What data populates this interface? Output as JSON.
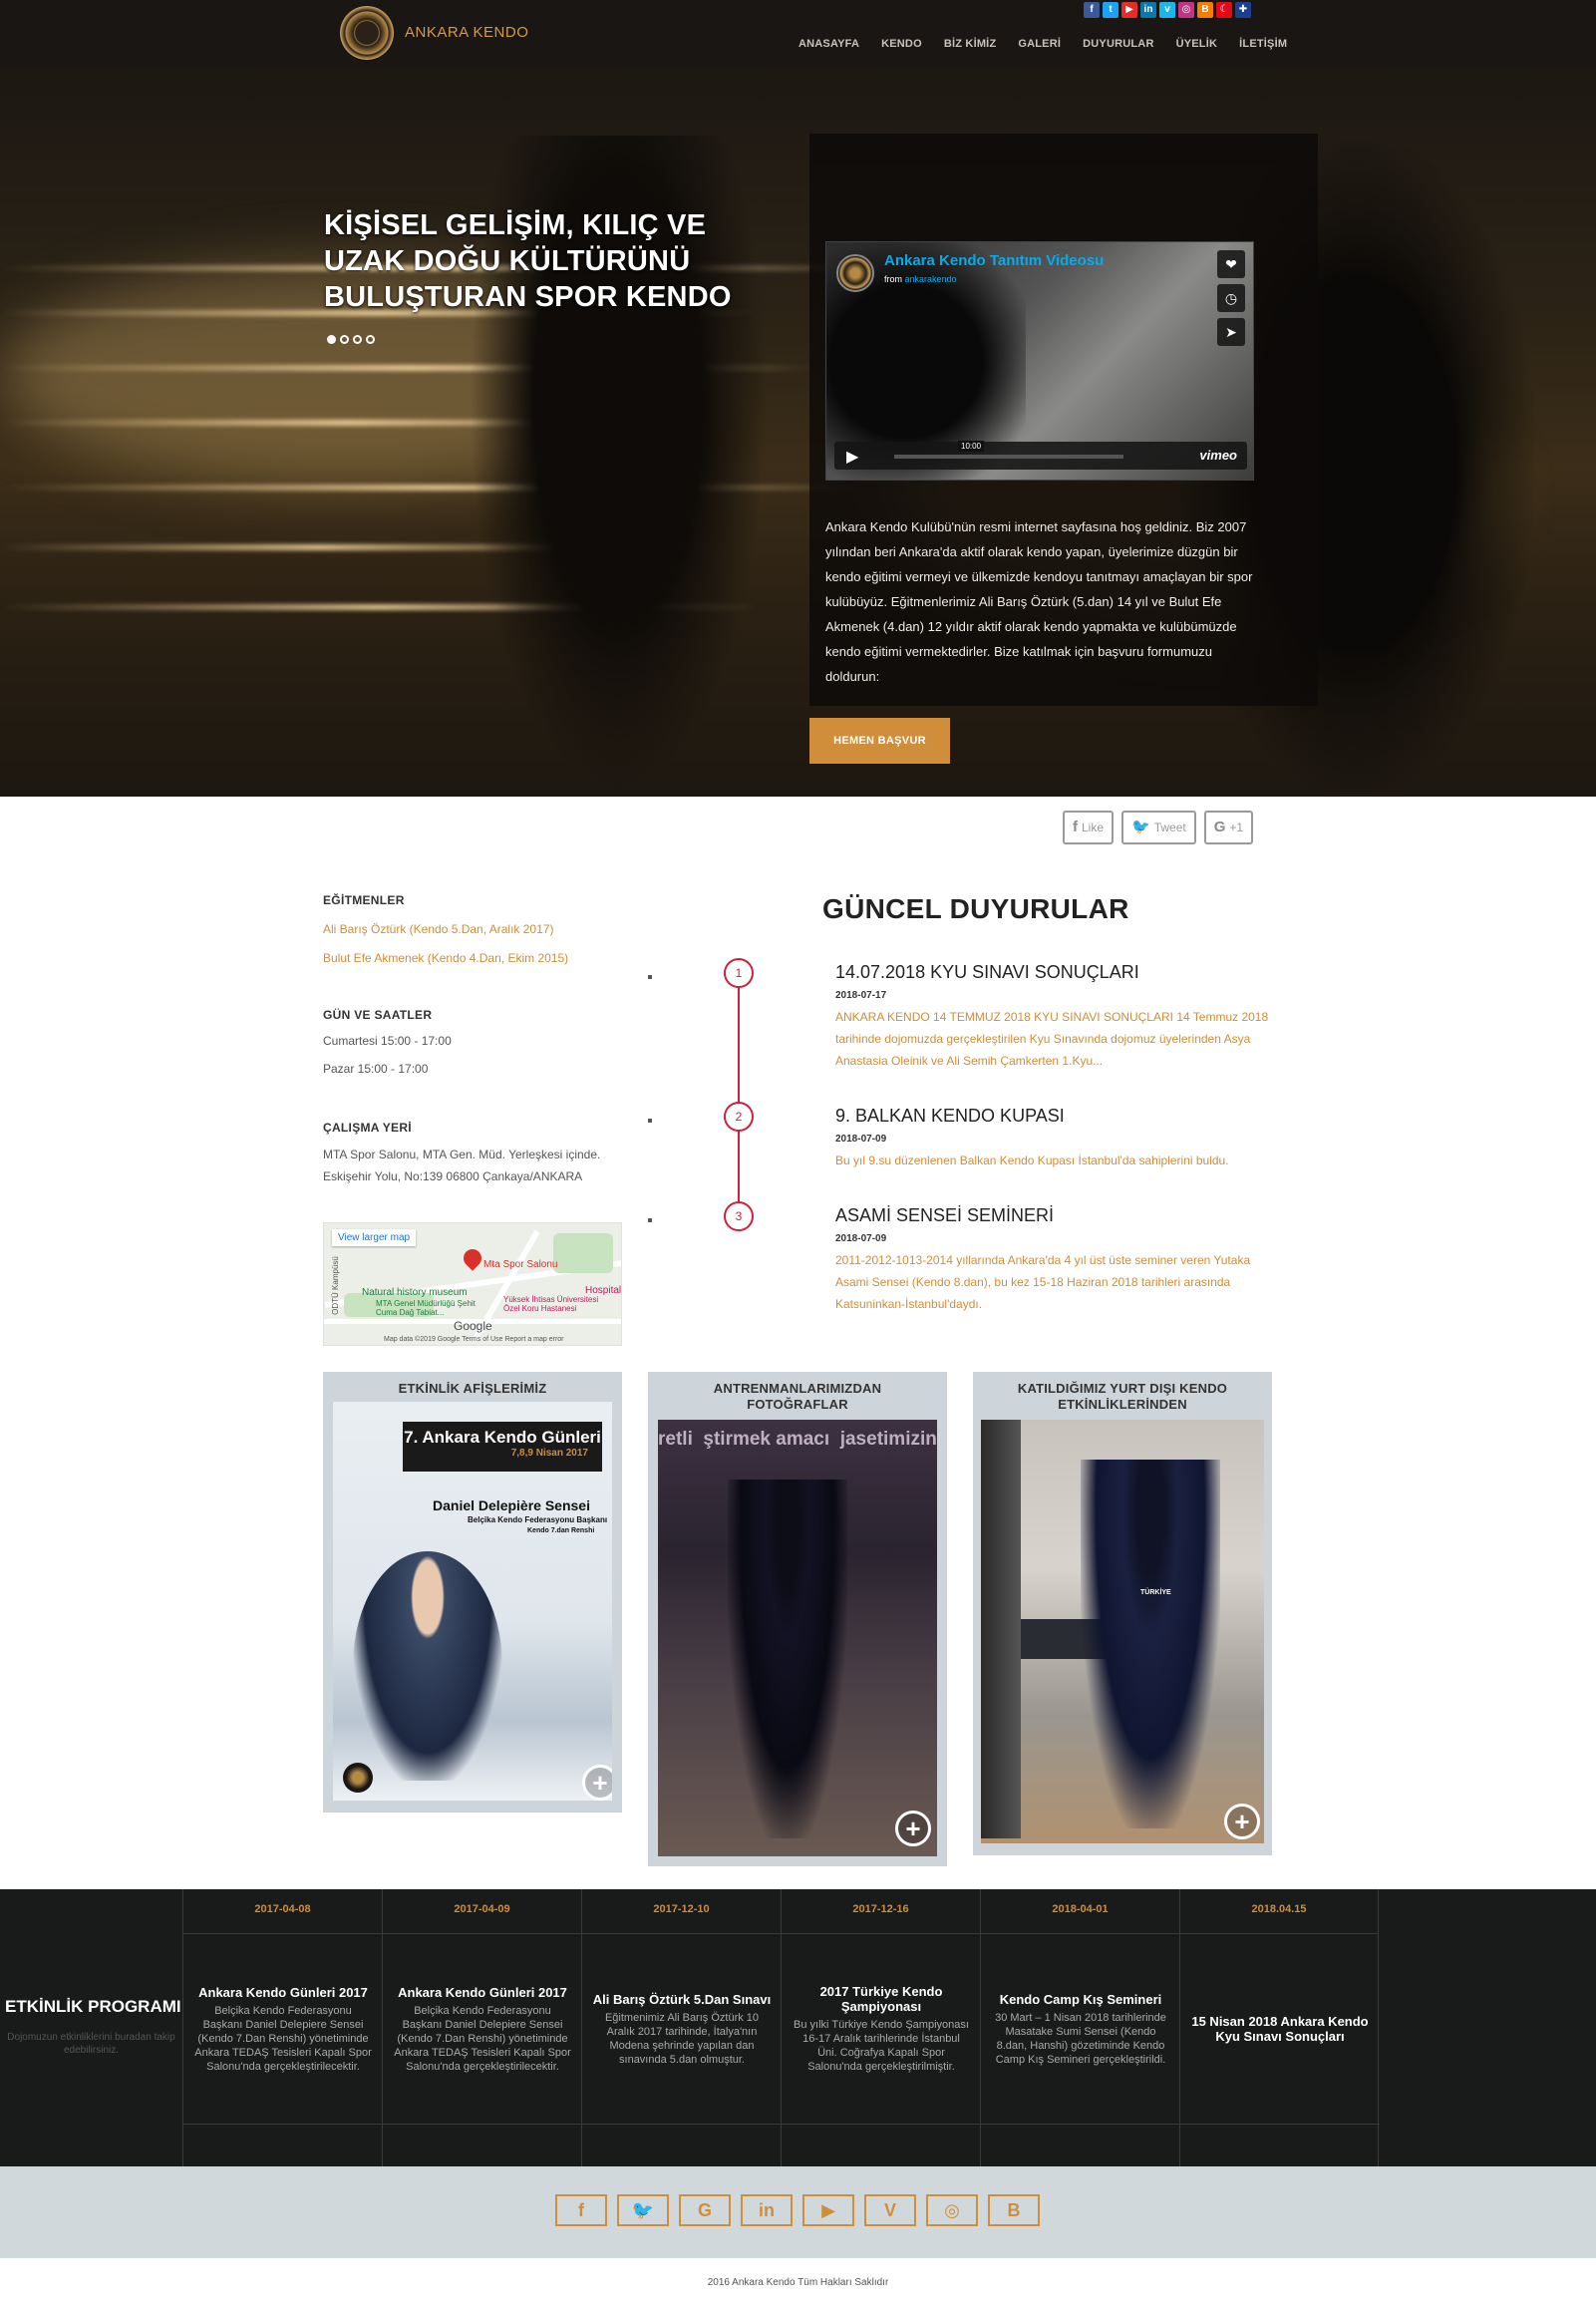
{
  "header": {
    "logo_text": "ANKARA KENDO",
    "nav": [
      "ANASAYFA",
      "KENDO",
      "BİZ KİMİZ",
      "GALERİ",
      "DUYURULAR",
      "ÜYELİK",
      "İLETİŞİM"
    ],
    "social_icons": [
      {
        "name": "facebook-icon",
        "glyph": "f",
        "color": "#3b5998"
      },
      {
        "name": "twitter-icon",
        "glyph": "t",
        "color": "#1da1f2"
      },
      {
        "name": "youtube-icon",
        "glyph": "▶",
        "color": "#e52d27"
      },
      {
        "name": "linkedin-icon",
        "glyph": "in",
        "color": "#0e76a8"
      },
      {
        "name": "vimeo-icon",
        "glyph": "v",
        "color": "#1ab7ea"
      },
      {
        "name": "instagram-icon",
        "glyph": "◎",
        "color": "#c13584"
      },
      {
        "name": "blogger-icon",
        "glyph": "B",
        "color": "#f57d00"
      },
      {
        "name": "flag-tr-icon",
        "glyph": "☾",
        "color": "#e30a17"
      },
      {
        "name": "flag-uk-icon",
        "glyph": "✚",
        "color": "#1c3f8f"
      }
    ]
  },
  "hero": {
    "title": "KİŞİSEL GELİŞİM, KILIÇ VE UZAK DOĞU KÜLTÜRÜNÜ BULUŞTURAN SPOR KENDO",
    "video": {
      "title": "Ankara Kendo Tanıtım Videosu",
      "from_prefix": "from",
      "from_user": "ankarakendo",
      "time": "10:00",
      "brand": "vimeo"
    },
    "description": "Ankara Kendo Kulübü'nün resmi internet sayfasına hoş geldiniz. Biz 2007 yılından beri Ankara'da aktif olarak kendo yapan, üyelerimize düzgün bir kendo eğitimi vermeyi ve ülkemizde kendoyu tanıtmayı amaçlayan bir spor kulübüyüz. Eğitmenlerimiz Ali Barış Öztürk (5.dan) 14 yıl ve Bulut Efe Akmenek (4.dan) 12 yıldır aktif olarak kendo yapmakta ve kulübümüzde kendo eğitimi vermektedirler. Bize katılmak için başvuru formumuzu doldurun:",
    "cta": "HEMEN BAŞVUR"
  },
  "share": {
    "like": "Like",
    "tweet": "Tweet",
    "gplus": "+1"
  },
  "info": {
    "trainers_h": "EĞİTMENLER",
    "trainers": [
      "Ali Barış Öztürk (Kendo 5.Dan, Aralık 2017)",
      "Bulut Efe Akmenek (Kendo 4.Dan, Ekim 2015)"
    ],
    "hours_h": "GÜN VE SAATLER",
    "hours": [
      "Cumartesi 15:00 - 17:00",
      "Pazar 15:00 - 17:00"
    ],
    "place_h": "ÇALIŞMA YERİ",
    "place": [
      "MTA Spor Salonu, MTA Gen. Müd. Yerleşkesi içinde.",
      "Eskişehir Yolu, No:139 06800 Çankaya/ANKARA"
    ],
    "map": {
      "larger": "View larger map",
      "pin": "Mta Spor Salonu",
      "museum": "Natural history museum",
      "museum2": "MTA Genel Müdürlüğü Şehit Cuma Dağ Tabiat...",
      "hospital": "Hospital",
      "hospital2": "Yüksek İhtisas Üniversitesi Özel Koru Hastanesi",
      "side": "ODTÜ Kampüsü",
      "google": "Google",
      "footer": "Map data ©2019 Google   Terms of Use   Report a map error"
    }
  },
  "news": {
    "title": "GÜNCEL DUYURULAR",
    "items": [
      {
        "num": "1",
        "title": "14.07.2018 KYU SINAVI SONUÇLARI",
        "date": "2018-07-17",
        "text": "ANKARA KENDO 14 TEMMUZ 2018 KYU SINAVI SONUÇLARI 14 Temmuz 2018 tarihinde dojomuzda gerçekleştirilen Kyu Sınavında dojomuz üyelerinden Asya Anastasia Oleinik ve Ali Semih Çamkerten 1.Kyu..."
      },
      {
        "num": "2",
        "title": "9. BALKAN KENDO KUPASI",
        "date": "2018-07-09",
        "text": "Bu yıl 9.su düzenlenen Balkan Kendo Kupası İstanbul'da sahiplerini buldu."
      },
      {
        "num": "3",
        "title": "ASAMİ SENSEİ SEMİNERİ",
        "date": "2018-07-09",
        "text": "2011-2012-1013-2014 yıllarında Ankara'da 4 yıl üst üste seminer veren Yutaka Asami Sensei (Kendo 8.dan), bu kez 15-18 Haziran 2018 tarihleri arasında Katsuninkan-İstanbul'daydı."
      }
    ]
  },
  "cards": [
    {
      "title": "ETKİNLİK AFİŞLERİMİZ",
      "poster_title": "7. Ankara Kendo Günleri",
      "poster_dates": "7,8,9 Nisan 2017",
      "poster_name": "Daniel Delepière Sensei",
      "poster_sub": "Belçika Kendo Federasyonu Başkanı",
      "poster_rank": "Kendo 7.dan Renshi"
    },
    {
      "title": "ANTRENMANLARIMIZDAN FOTOĞRAFLAR",
      "banner_text": "retli  ştirmek amacı  jasetimizin"
    },
    {
      "title": "KATILDIĞIMIZ YURT DIŞI KENDO ETKİNLİKLERİNDEN",
      "badge": "TÜRKİYE"
    }
  ],
  "events": {
    "title": "ETKİNLİK PROGRAMI",
    "subtitle": "Dojomuzun etkinliklerini buradan takip edebilirsiniz.",
    "items": [
      {
        "date": "2017-04-08",
        "name": "Ankara Kendo Günleri 2017",
        "text": "Belçika Kendo Federasyonu Başkanı Daniel Delepiere Sensei (Kendo 7.Dan Renshi) yönetiminde Ankara TEDAŞ Tesisleri Kapalı Spor Salonu'nda gerçekleştirilecektir."
      },
      {
        "date": "2017-04-09",
        "name": "Ankara Kendo Günleri 2017",
        "text": "Belçika Kendo Federasyonu Başkanı Daniel Delepiere Sensei (Kendo 7.Dan Renshi) yönetiminde Ankara TEDAŞ Tesisleri Kapalı Spor Salonu'nda gerçekleştirilecektir."
      },
      {
        "date": "2017-12-10",
        "name": "Ali Barış Öztürk 5.Dan Sınavı",
        "text": "Eğitmenimiz Ali Barış Öztürk 10 Aralık 2017 tarihinde, İtalya'nın Modena şehrinde yapılan dan sınavında 5.dan olmuştur."
      },
      {
        "date": "2017-12-16",
        "name": "2017 Türkiye Kendo Şampiyonası",
        "text": "Bu yılki Türkiye Kendo Şampiyonası 16-17 Aralık tarihlerinde İstanbul Üni. Coğrafya Kapalı Spor Salonu'nda gerçekleştirilmiştir."
      },
      {
        "date": "2018-04-01",
        "name": "Kendo Camp Kış Semineri",
        "text": "30 Mart – 1 Nisan 2018 tarihlerinde Masatake Sumi Sensei (Kendo 8.dan, Hanshi) gözetiminde Kendo Camp Kış Semineri gerçekleştirildi."
      },
      {
        "date": "2018.04.15",
        "name": "15 Nisan 2018 Ankara Kendo Kyu Sınavı Sonuçları",
        "text": ""
      }
    ]
  },
  "footer": {
    "icons": [
      {
        "name": "facebook-icon",
        "glyph": "f"
      },
      {
        "name": "twitter-icon",
        "glyph": "🐦"
      },
      {
        "name": "google-icon",
        "glyph": "G"
      },
      {
        "name": "linkedin-icon",
        "glyph": "in"
      },
      {
        "name": "youtube-icon",
        "glyph": "▶"
      },
      {
        "name": "vimeo-icon",
        "glyph": "V"
      },
      {
        "name": "instagram-icon",
        "glyph": "◎"
      },
      {
        "name": "blogger-icon",
        "glyph": "B"
      }
    ],
    "copyright": "2016 Ankara Kendo Tüm Hakları Saklıdır"
  }
}
